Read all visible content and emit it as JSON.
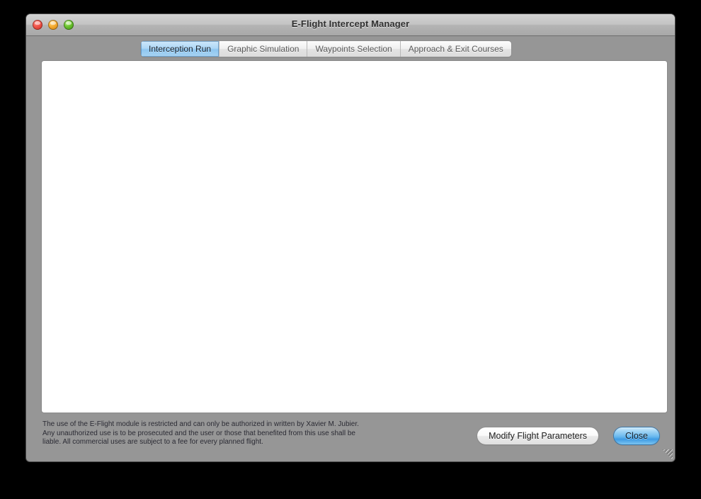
{
  "window": {
    "title": "E-Flight Intercept Manager",
    "controls": [
      {
        "name": "close-button",
        "color": "#f0554a"
      },
      {
        "name": "minimize-button",
        "color": "#f5ab2e"
      },
      {
        "name": "zoom-button",
        "color": "#6bc42e"
      }
    ]
  },
  "tabs": [
    {
      "label": "Interception Run",
      "active": true
    },
    {
      "label": "Graphic Simulation",
      "active": false
    },
    {
      "label": "Waypoints Selection",
      "active": false
    },
    {
      "label": "Approach & Exit Courses",
      "active": false
    }
  ],
  "content": {
    "body_text": ""
  },
  "footer": {
    "disclaimer_lines": [
      "The use of the E-Flight module is restricted and can only be authorized in written by Xavier M. Jubier.",
      "Any unauthorized use is to be prosecuted and the user or those that benefited from this use shall be",
      "liable. All commercial uses are subject to a fee for every planned flight."
    ],
    "modify_button": "Modify Flight Parameters",
    "close_button": "Close"
  },
  "colors": {
    "window_background": "#969696",
    "titlebar_top": "#d3d3d3",
    "content_background": "#ffffff",
    "active_tab_blue": "#8ec6f0",
    "default_button_blue": "#3f9ce4"
  }
}
